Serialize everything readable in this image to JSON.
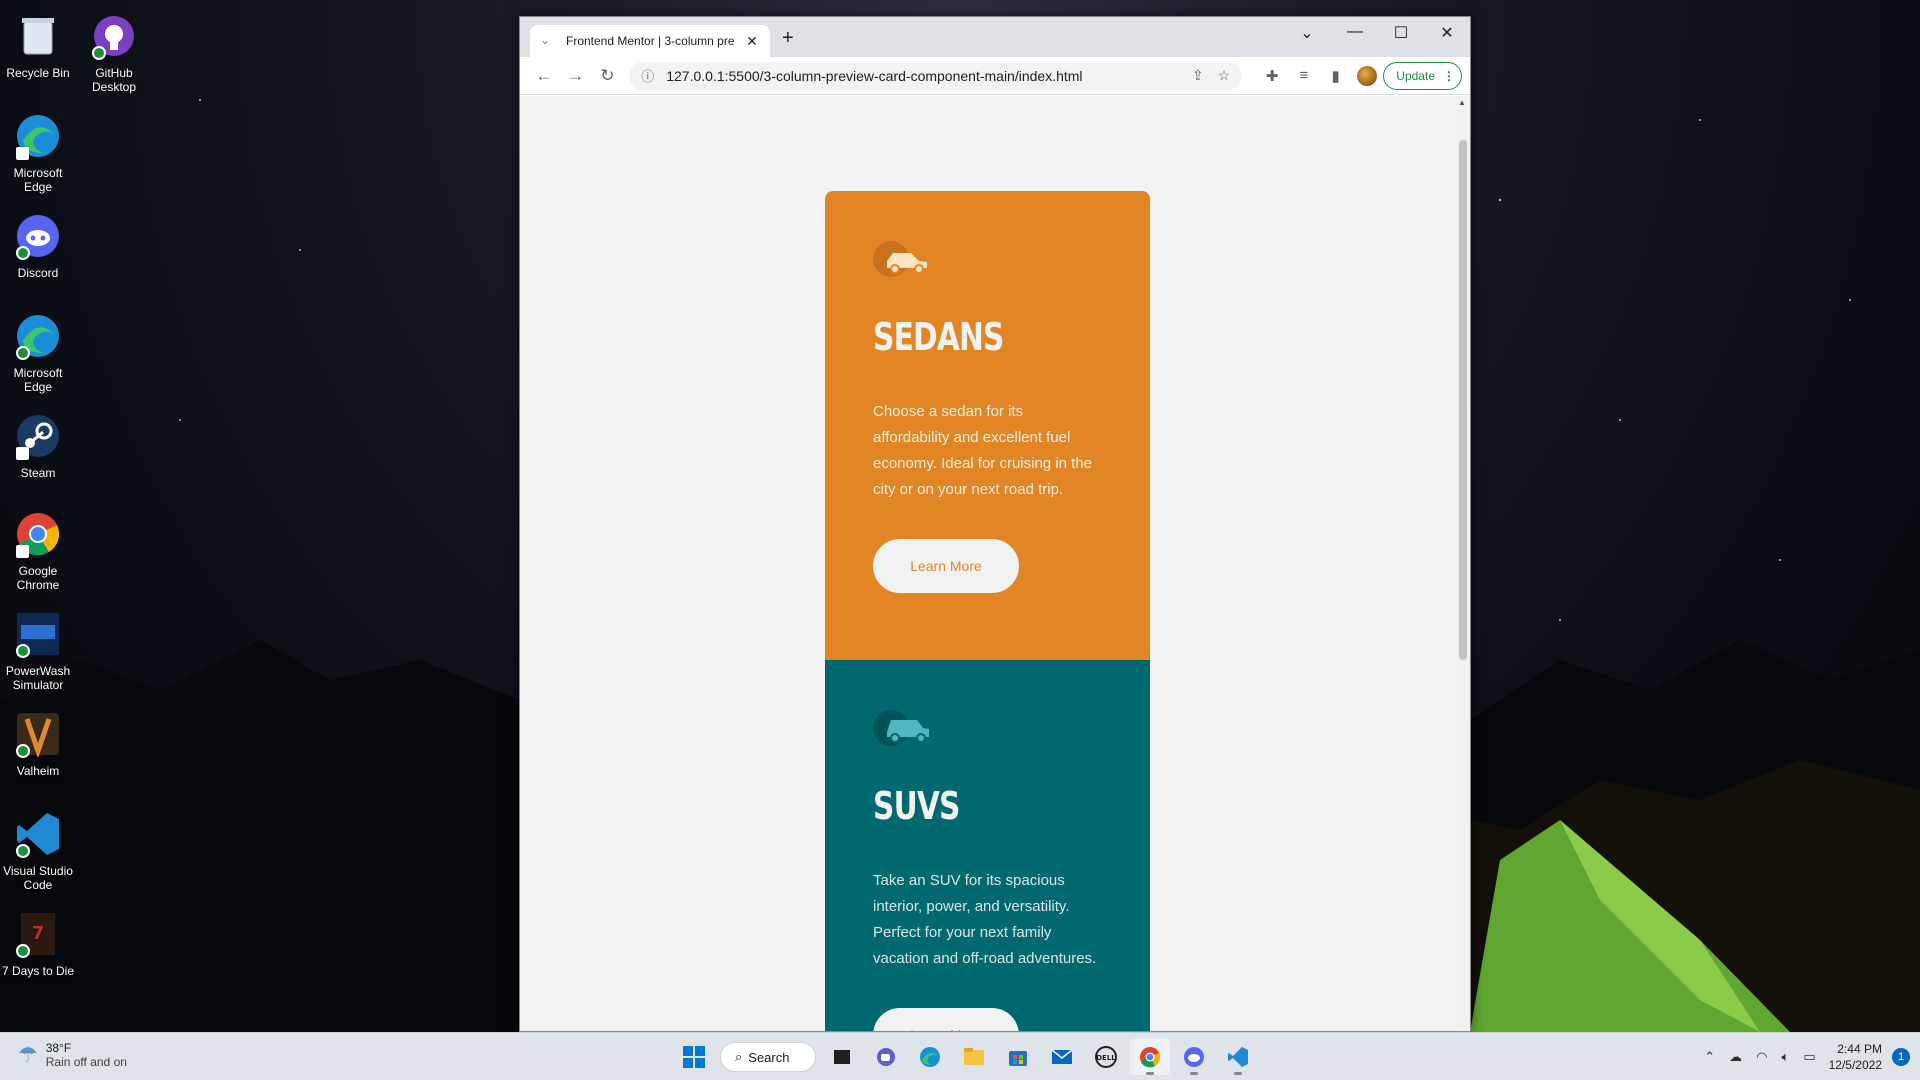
{
  "desktop": {
    "icons": [
      {
        "label": "Recycle Bin",
        "icon": "recycle-bin-icon"
      },
      {
        "label": "GitHub Desktop",
        "icon": "github-desktop-icon"
      },
      {
        "label": "Microsoft Edge",
        "icon": "edge-icon"
      },
      {
        "label": "Discord",
        "icon": "discord-icon"
      },
      {
        "label": "Microsoft Edge",
        "icon": "edge-icon"
      },
      {
        "label": "Steam",
        "icon": "steam-icon"
      },
      {
        "label": "Google Chrome",
        "icon": "chrome-icon"
      },
      {
        "label": "PowerWash Simulator",
        "icon": "powerwash-icon"
      },
      {
        "label": "Valheim",
        "icon": "valheim-icon"
      },
      {
        "label": "Visual Studio Code",
        "icon": "vscode-icon"
      },
      {
        "label": "7 Days to Die",
        "icon": "7days-icon"
      }
    ]
  },
  "browser": {
    "tab_title": "Frontend Mentor | 3-column pre",
    "url": "127.0.0.1:5500/3-column-preview-card-component-main/index.html",
    "update_label": "Update"
  },
  "page": {
    "cards": [
      {
        "title": "Sedans",
        "text": "Choose a sedan for its affordability and excellent fuel economy. Ideal for cruising in the city or on your next road trip.",
        "button": "Learn More",
        "color": "#e28625"
      },
      {
        "title": "SUVs",
        "text": "Take an SUV for its spacious interior, power, and versatility. Perfect for your next family vacation and off-road adventures.",
        "button": "Learn More",
        "color": "#006970"
      }
    ],
    "background": "#f2f2f2"
  },
  "taskbar": {
    "weather_temp": "38°F",
    "weather_desc": "Rain off and on",
    "search_label": "Search",
    "time": "2:44 PM",
    "date": "12/5/2022",
    "notification_count": "1"
  }
}
